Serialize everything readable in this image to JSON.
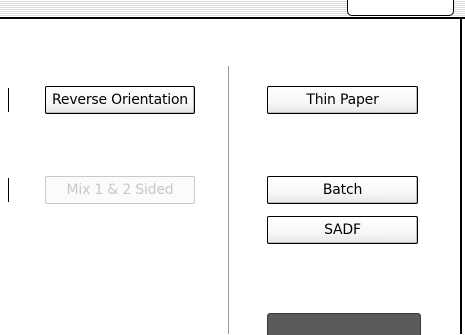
{
  "left": {
    "reverse_orientation_label": "Reverse Orientation",
    "mix_sided_label": "Mix 1 & 2 Sided"
  },
  "right": {
    "thin_paper_label": "Thin Paper",
    "batch_label": "Batch",
    "sadf_label": "SADF"
  },
  "colors": {
    "button_border": "#000000",
    "disabled_text": "#c8c8c8",
    "bottom_button": "#5a5a5a"
  }
}
